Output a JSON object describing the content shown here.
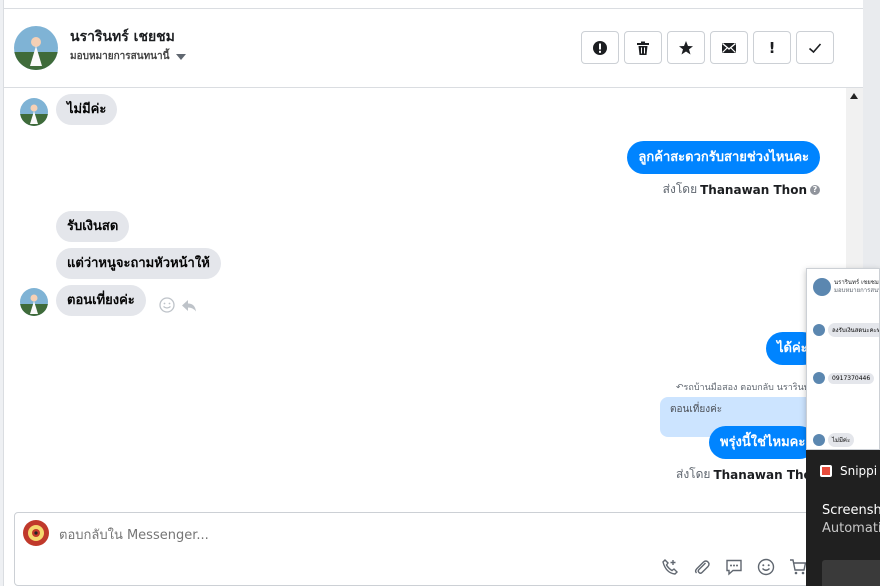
{
  "header": {
    "contact_name": "นรารินทร์ เชยชม",
    "assign_label": "มอบหมายการสนทนานี้",
    "actions": [
      {
        "icon": "alert-circle-icon"
      },
      {
        "icon": "trash-icon"
      },
      {
        "icon": "star-icon"
      },
      {
        "icon": "envelope-icon"
      },
      {
        "icon": "exclamation-icon",
        "label": "!"
      },
      {
        "icon": "checkmark-icon"
      }
    ]
  },
  "messages": {
    "m1": "ไม่มีค่ะ",
    "m2": "ลูกค้าสะดวกรับสายช่วงไหนคะ",
    "m2_sent_prefix": "ส่งโดย",
    "m2_sent_name": "Thanawan Thon",
    "m3": "รับเงินสด",
    "m4": "แต่ว่าหนูจะถามหัวหน้าให้",
    "m5": "ตอนเที่ยงค่ะ",
    "m6": "ได้ค่ะ",
    "reply_context": "รถบ้านมือสอง ตอบกลับ นรารินท",
    "quoted": "ตอนเที่ยงค่ะ",
    "m7": "พรุ่งนี้ใช่ไหมคะ",
    "m7_sent_prefix": "ส่งโดย",
    "m7_sent_name": "Thanawan Thon"
  },
  "composer": {
    "placeholder": "ตอบกลับใน Messenger..."
  },
  "popup": {
    "name": "นรารินทร์ เชยชม",
    "sub": "มอบหมายการสนทนานี้",
    "b1": "ลงรับเงินสดนะคะท",
    "b2": "0917370446",
    "b3": "ไม่มีค่ะ"
  },
  "notification": {
    "title": "Snippi",
    "line1": "Screensho",
    "line2": "Automati"
  },
  "colors": {
    "accent": "#0084ff",
    "incoming_bubble": "#e4e6eb",
    "quoted_bg": "#cce4ff"
  }
}
